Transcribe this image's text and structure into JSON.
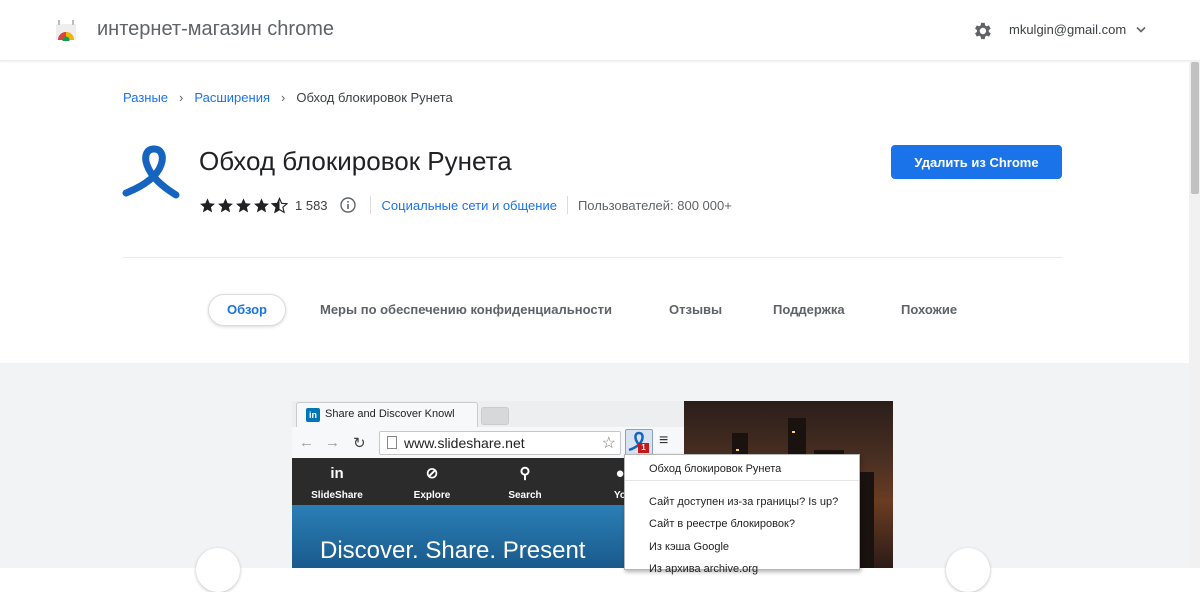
{
  "header": {
    "store_title": "интернет-магазин chrome",
    "account_email": "mkulgin@gmail.com"
  },
  "breadcrumb": [
    "Разные",
    "Расширения",
    "Обход блокировок Рунета"
  ],
  "extension": {
    "title": "Обход блокировок Рунета",
    "action_button": "Удалить из Chrome",
    "rating": 4.5,
    "rating_count": "1 583",
    "category": "Социальные сети и общение",
    "users": "Пользователей: 800 000+"
  },
  "tabs": [
    {
      "label": "Обзор",
      "active": true
    },
    {
      "label": "Меры по обеспечению конфиденциальности",
      "active": false
    },
    {
      "label": "Отзывы",
      "active": false
    },
    {
      "label": "Поддержка",
      "active": false
    },
    {
      "label": "Похожие",
      "active": false
    }
  ],
  "screenshot": {
    "tab_title": "Share and Discover Knowl",
    "url": "www.slideshare.net",
    "nav": [
      "SlideShare",
      "Explore",
      "Search",
      "Yo"
    ],
    "hero": "Discover. Share. Present",
    "popup_items": [
      "Обход блокировок Рунета",
      "Сайт доступен из-за границы? Is up?",
      "Сайт в реестре блокировок?",
      "Из кэша Google",
      "Из архива archive.org"
    ],
    "badge": "1"
  },
  "colors": {
    "accent": "#1a73e8",
    "ribbon": "#1565c0",
    "gallery_bg": "#f1f3f4"
  }
}
